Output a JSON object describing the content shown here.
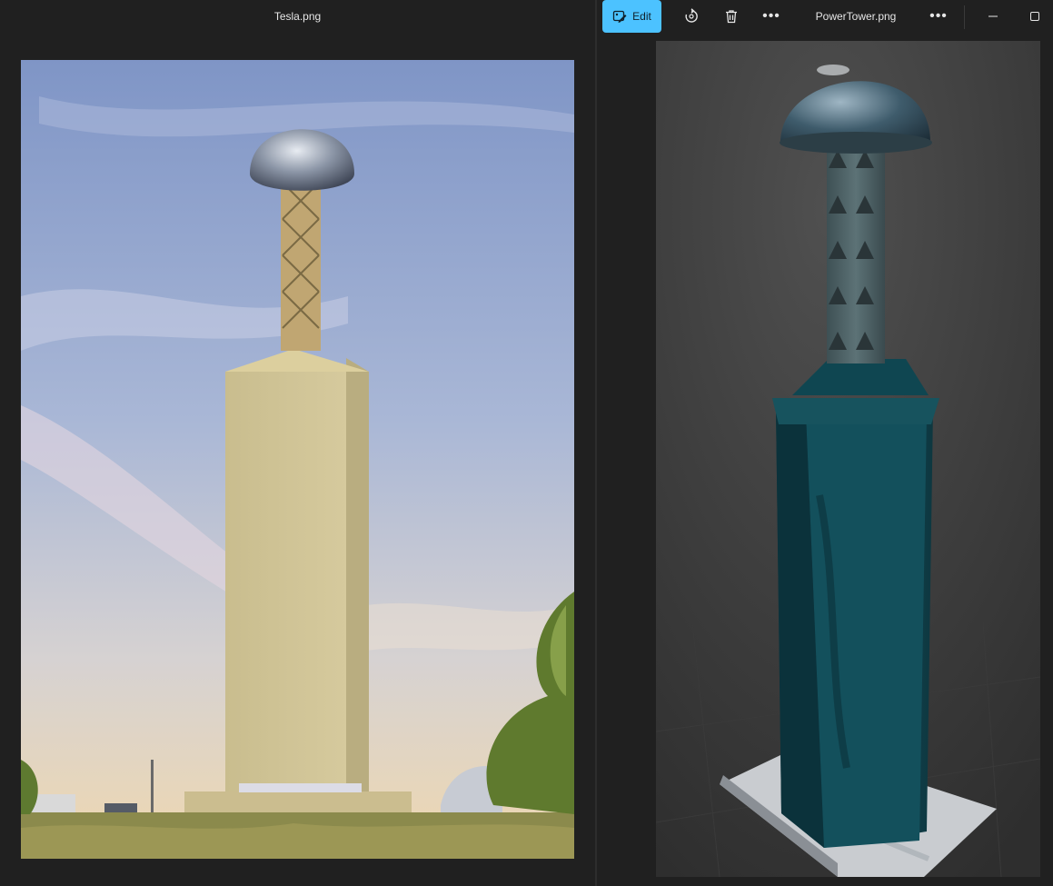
{
  "left_window": {
    "title": "Tesla.png"
  },
  "right_window": {
    "title": "PowerTower.png",
    "toolbar": {
      "edit_label": "Edit",
      "edit_icon": "edit-image-icon",
      "rotate_icon": "rotate-icon",
      "delete_icon": "trash-icon",
      "more_icon": "more-horizontal-icon",
      "more_label": "•••"
    },
    "window_controls": {
      "minimize_icon": "minimize-icon",
      "maximize_icon": "maximize-icon"
    }
  },
  "colors": {
    "background": "#202020",
    "accent": "#4cc2ff",
    "text": "#e6e6e6"
  }
}
